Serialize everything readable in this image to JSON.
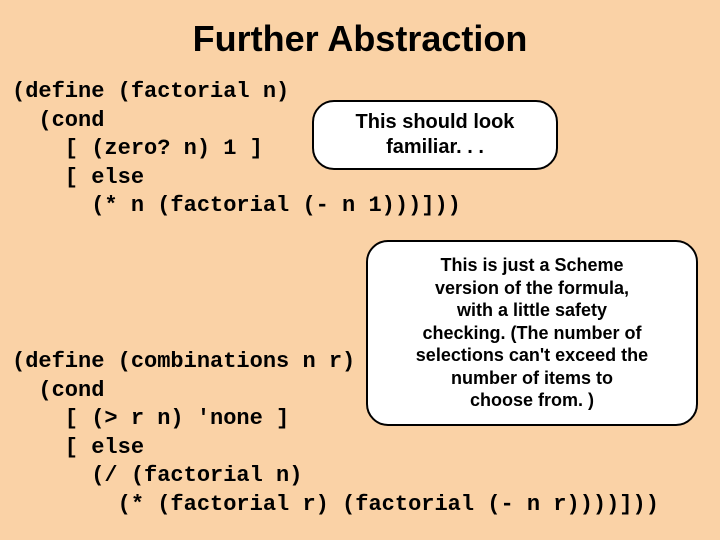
{
  "title": "Further Abstraction",
  "code1": {
    "l1": "(define (factorial n)",
    "l2": "  (cond",
    "l3": "    [ (zero? n) 1 ]",
    "l4": "    [ else",
    "l5": "      (* n (factorial (- n 1)))]))"
  },
  "callout1": {
    "l1": "This should look",
    "l2": "familiar. . ."
  },
  "callout2": {
    "l1": "This is just a Scheme",
    "l2": "version of the formula,",
    "l3": "with a little safety",
    "l4": "checking.  (The number of",
    "l5": "selections can't exceed the",
    "l6": "number of items to",
    "l7": "choose from. )"
  },
  "code2": {
    "l1": "(define (combinations n r)",
    "l2": "  (cond",
    "l3": "    [ (> r n) 'none ]",
    "l4": "    [ else",
    "l5": "      (/ (factorial n)",
    "l6": "        (* (factorial r) (factorial (- n r))))]))"
  }
}
